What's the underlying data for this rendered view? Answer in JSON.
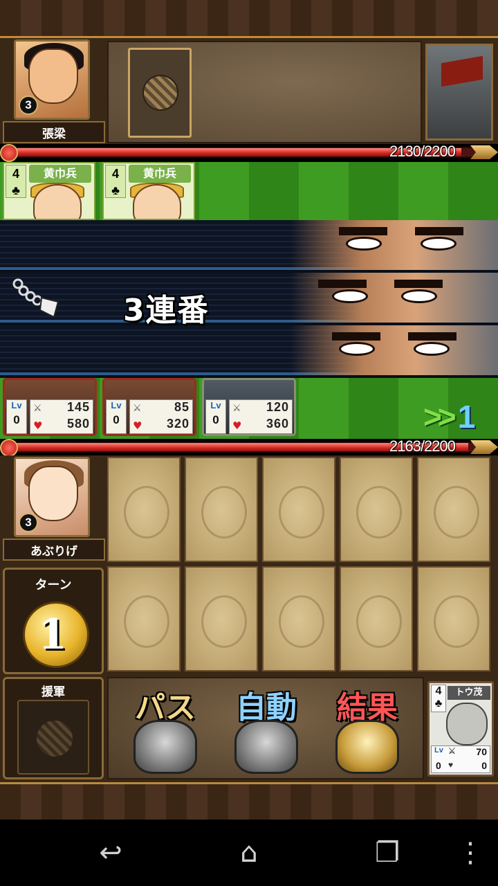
{
  "enemy": {
    "name": "張梁",
    "level": "3",
    "hp_text": "2130/2200",
    "hp_fraction": 0.968,
    "units": [
      {
        "rank": "4",
        "suit": "♣",
        "name": "黄巾兵"
      },
      {
        "rank": "4",
        "suit": "♣",
        "name": "黄巾兵"
      }
    ]
  },
  "combo": {
    "text": "3連番"
  },
  "player": {
    "name": "あぶりげ",
    "level": "3",
    "hp_text": "2163/2200",
    "hp_fraction": 0.983,
    "units": [
      {
        "lv_label": "Lv",
        "level": "0",
        "attack": "145",
        "hp": "580"
      },
      {
        "lv_label": "Lv",
        "level": "0",
        "attack": "85",
        "hp": "320"
      },
      {
        "lv_label": "Lv",
        "level": "0",
        "attack": "120",
        "hp": "360"
      }
    ],
    "fast_forward_count": "1"
  },
  "turn": {
    "label": "ターン",
    "number": "1"
  },
  "reinforcement": {
    "label": "援軍"
  },
  "actions": {
    "pass": "パス",
    "auto": "自動",
    "result": "結果"
  },
  "hand_card": {
    "rank": "4",
    "suit": "♣",
    "name": "トウ茂",
    "lv_label": "Lv",
    "level": "0",
    "attack": "70",
    "hp": "0"
  },
  "colors": {
    "hp_red": "#d1261f",
    "grass": "#3f9c22",
    "wood": "#3a2816",
    "gold": "#e8b42a"
  }
}
